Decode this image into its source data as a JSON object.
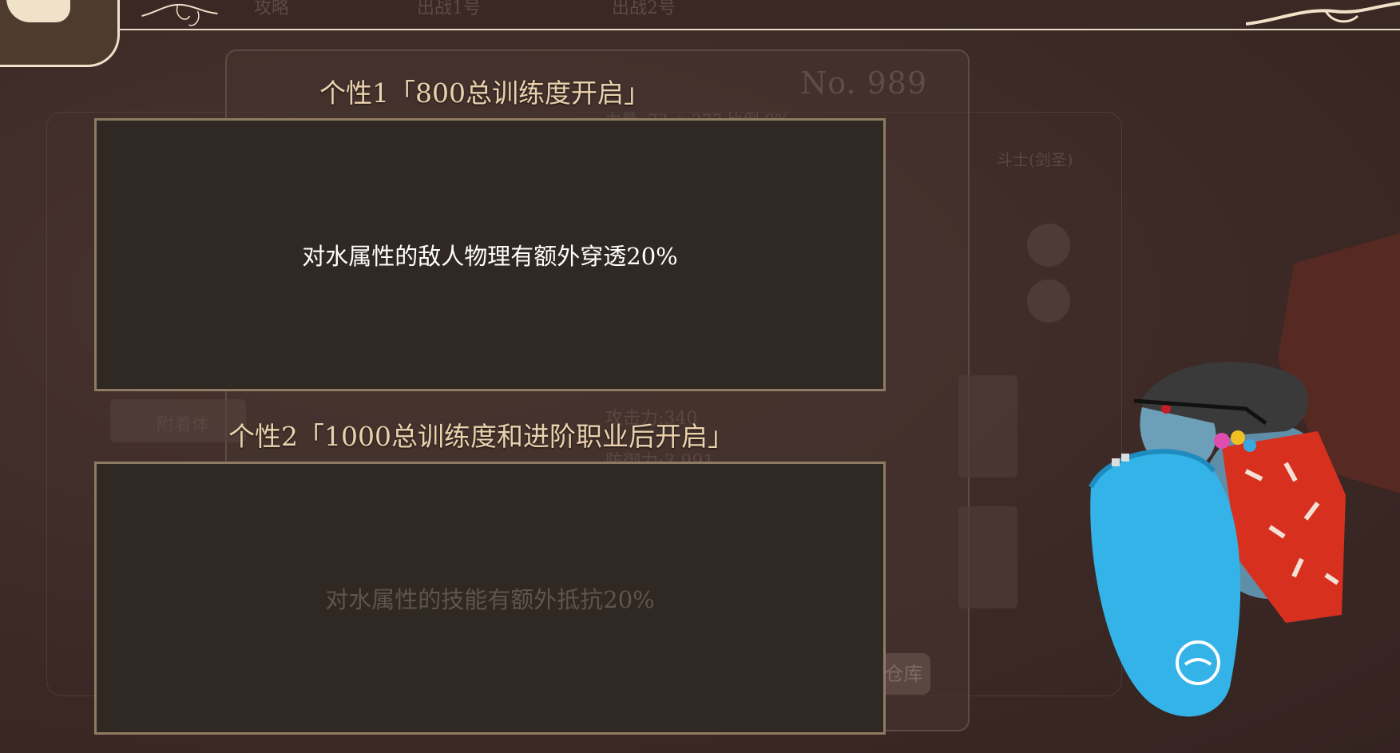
{
  "top_tabs": [
    "攻略",
    "出战1号",
    "出战2号"
  ],
  "card_number": "No. 989",
  "background_faint": {
    "stat1": "力量: 73 + 277  比例:0%",
    "stat2": "攻击力:340",
    "stat3": "防御力:3,991",
    "class_label": "斗士(剑圣)",
    "attach_label": "附着体",
    "warehouse_label": "仓库"
  },
  "traits": [
    {
      "title": "个性1「800总训练度开启」",
      "description": "对水属性的敌人物理有额外穿透20%",
      "unlocked": true
    },
    {
      "title": "个性2「1000总训练度和进阶职业后开启」",
      "description": "对水属性的技能有额外抵抗20%",
      "unlocked": false
    }
  ],
  "icons": {
    "back": "back-arrow-icon",
    "character": "surfer-monster-character"
  },
  "colors": {
    "background": "#3d2a27",
    "title": "#e9d2ad",
    "box_border": "#8f7b63",
    "box_fill": "#302822",
    "active_text": "#ffffff",
    "locked_text": "#5f554c"
  }
}
